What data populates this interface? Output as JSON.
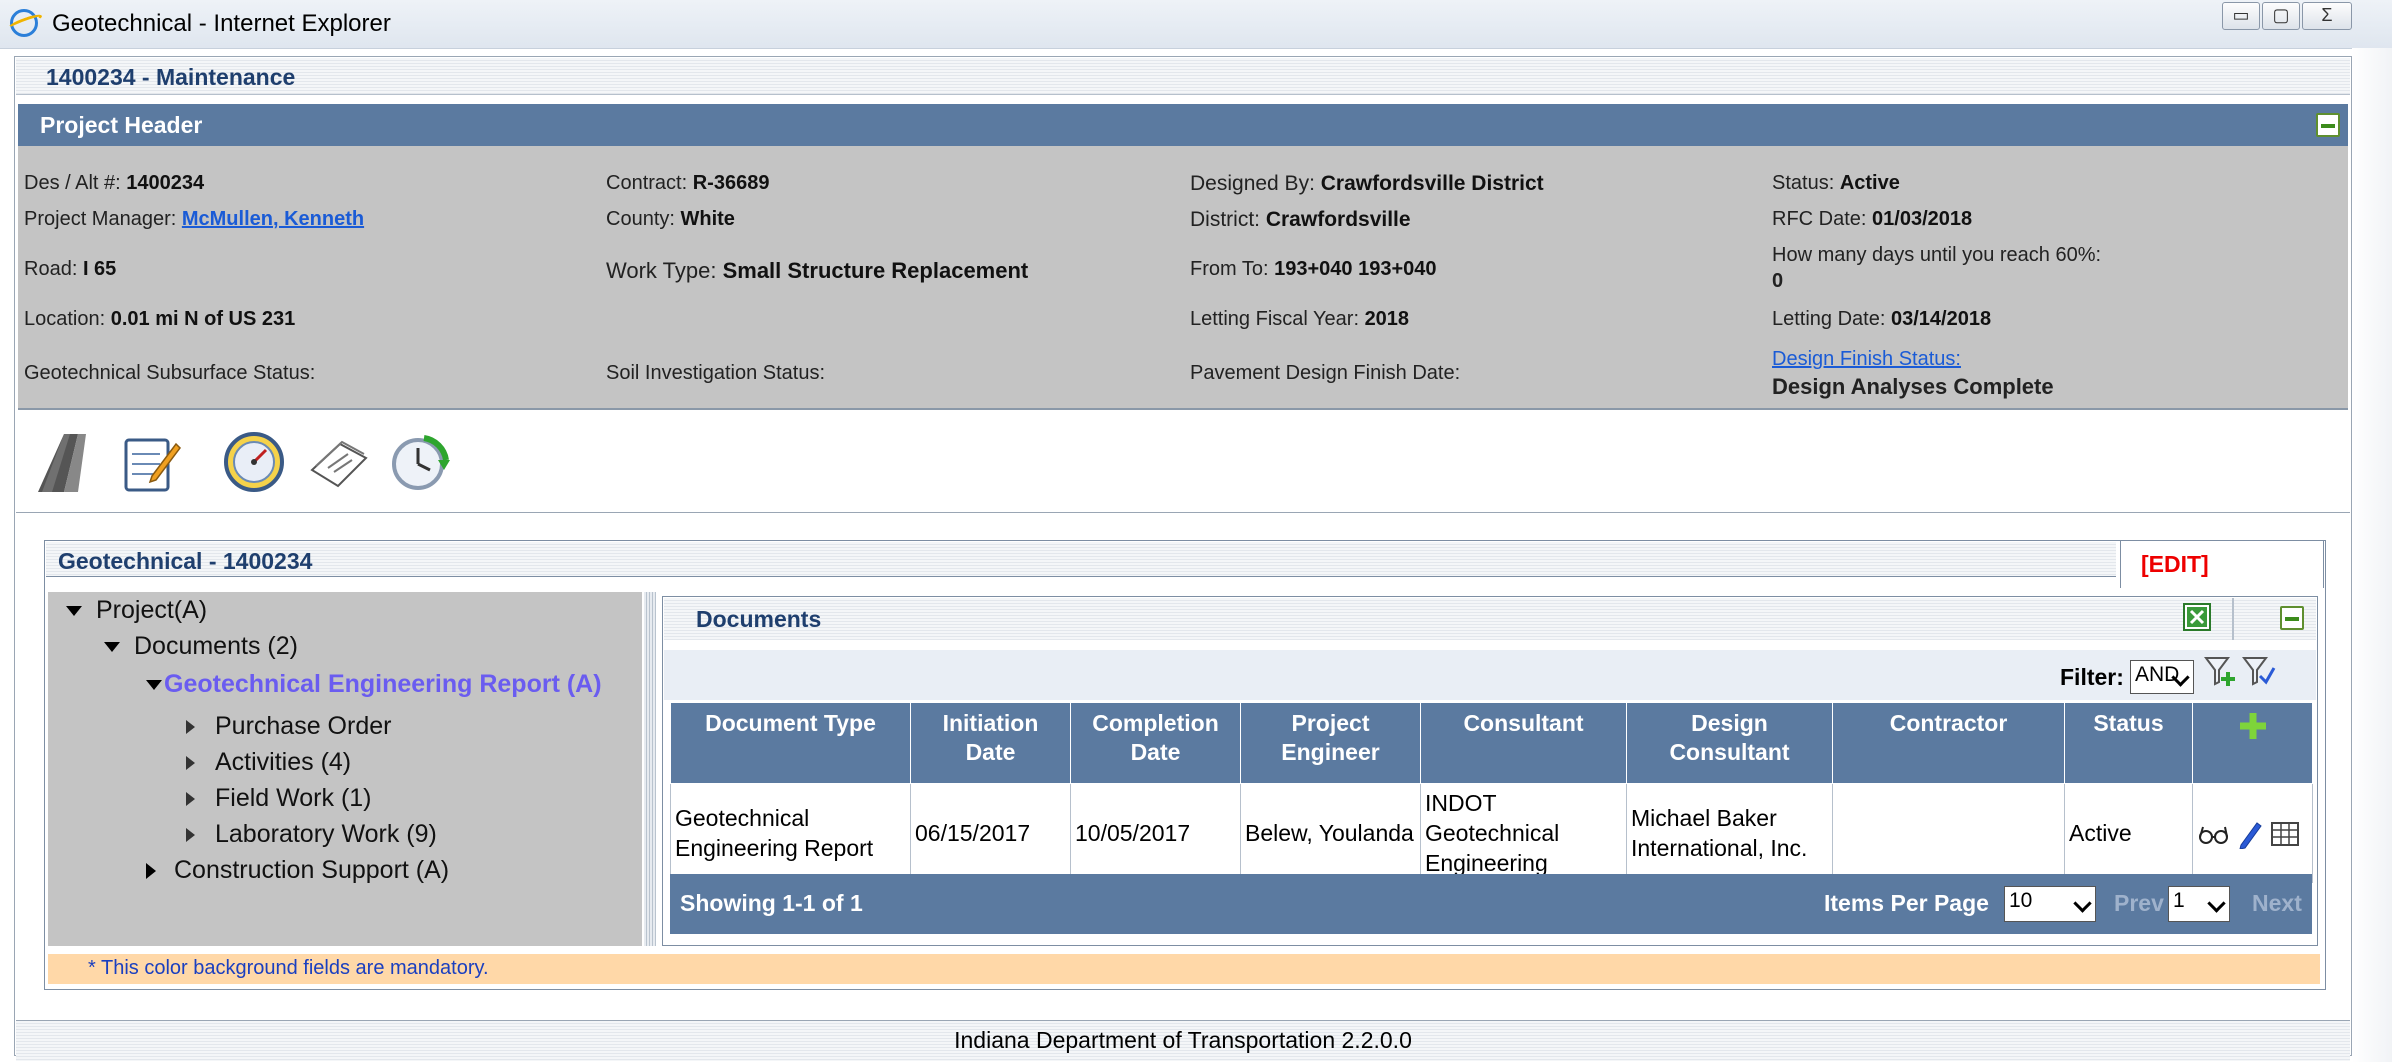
{
  "window": {
    "title": "Geotechnical - Internet Explorer",
    "btn_min": "▭",
    "btn_max": "▢",
    "btn_close": "Σ"
  },
  "maintenance": {
    "label": "1400234 - Maintenance"
  },
  "project_header": {
    "title": "Project Header",
    "fields": {
      "des_label": "Des / Alt #:",
      "des_value": "1400234",
      "pm_label": "Project Manager:",
      "pm_value": "McMullen, Kenneth",
      "road_label": "Road:",
      "road_value": "I 65",
      "location_label": "Location:",
      "location_value": "0.01 mi N of US 231",
      "geo_sub_label": "Geotechnical Subsurface Status:",
      "contract_label": "Contract:",
      "contract_value": "R-36689",
      "county_label": "County:",
      "county_value": "White",
      "worktype_label": "Work Type:",
      "worktype_value": "Small Structure Replacement",
      "soil_label": "Soil Investigation Status:",
      "designed_label": "Designed By:",
      "designed_value": "Crawfordsville District",
      "district_label": "District:",
      "district_value": "Crawfordsville",
      "fromto_label": "From To:",
      "fromto_value": "193+040 193+040",
      "fiscal_label": "Letting Fiscal Year:",
      "fiscal_value": "2018",
      "pavement_label": "Pavement Design Finish Date:",
      "status_label": "Status:",
      "status_value": "Active",
      "rfc_label": "RFC Date:",
      "rfc_value": "01/03/2018",
      "days_label": "How many days until you reach 60%:",
      "days_value": "0",
      "letting_label": "Letting Date:",
      "letting_value": "03/14/2018",
      "dfs_label": "Design Finish Status:",
      "dfs_value": "Design Analyses Complete"
    }
  },
  "toolbar_icons": [
    "road-icon",
    "notepad-icon",
    "gauge-icon",
    "documents-icon",
    "clock-refresh-icon"
  ],
  "geotech": {
    "title": "Geotechnical - 1400234",
    "edit_label": "[EDIT]",
    "tree": [
      {
        "label": "Project(A)"
      },
      {
        "label": "Documents (2)"
      },
      {
        "label": "Geotechnical Engineering Report (A)"
      },
      {
        "label": "Purchase Order"
      },
      {
        "label": "Activities (4)"
      },
      {
        "label": "Field Work (1)"
      },
      {
        "label": "Laboratory Work (9)"
      },
      {
        "label": "Construction Support (A)"
      }
    ]
  },
  "documents": {
    "title": "Documents",
    "filter_label": "Filter:",
    "filter_value": "AND",
    "columns": [
      "Document Type",
      "Initiation Date",
      "Completion Date",
      "Project Engineer",
      "Consultant",
      "Design Consultant",
      "Contractor",
      "Status"
    ],
    "rows": [
      {
        "document_type": "Geotechnical Engineering Report",
        "initiation_date": "06/15/2017",
        "completion_date": "10/05/2017",
        "project_engineer": "Belew, Youlanda",
        "consultant": "INDOT Geotechnical Engineering",
        "design_consultant": "Michael Baker International, Inc.",
        "contractor": "",
        "status": "Active"
      }
    ],
    "pager": {
      "showing": "Showing 1-1 of 1",
      "items_label": "Items Per Page",
      "items_value": "10",
      "prev": "Prev",
      "page_value": "1",
      "next": "Next"
    }
  },
  "mandatory_note": "* This color background fields are mandatory.",
  "footer": "Indiana Department of Transportation 2.2.0.0",
  "colors": {
    "header_blue": "#5b7aa0",
    "panel_gray": "#c4c4c4",
    "title_navy": "#1f3f6e",
    "edit_red": "#ee0000",
    "mandatory_orange": "#ffd8a8",
    "tree_selected": "#6a5cf0"
  }
}
